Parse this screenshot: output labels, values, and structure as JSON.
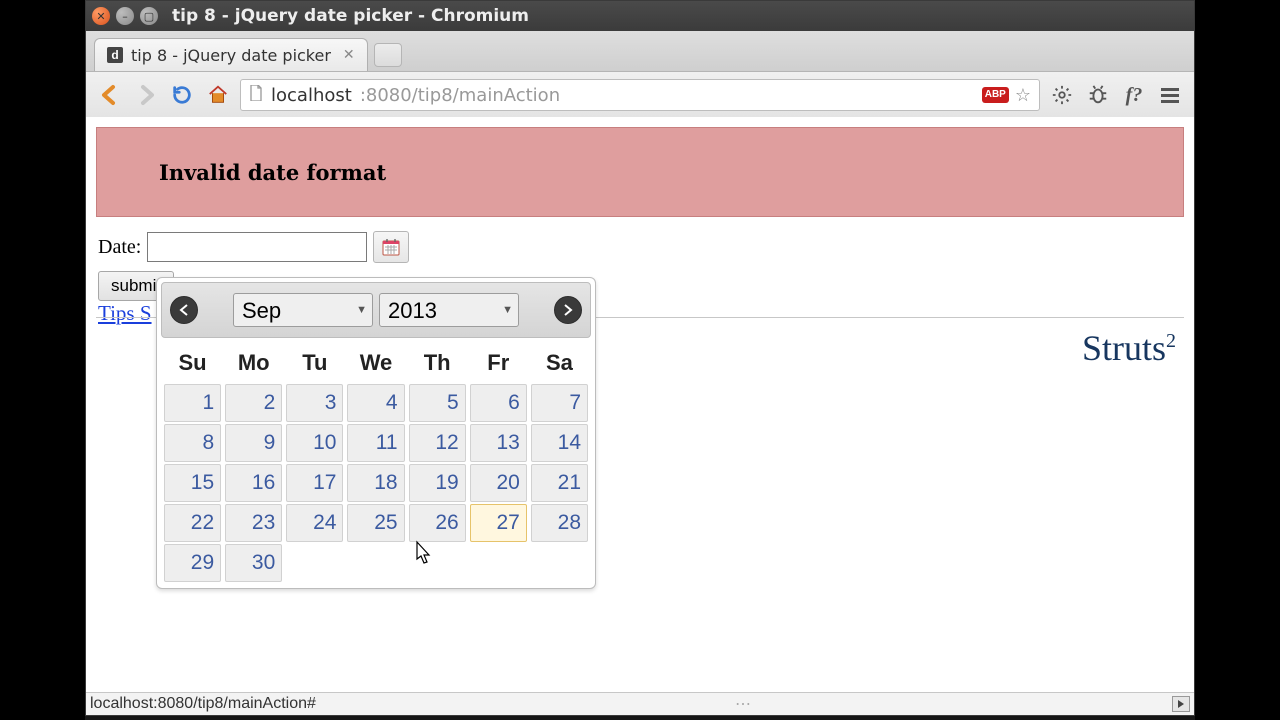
{
  "window": {
    "title": "tip 8 - jQuery date picker - Chromium"
  },
  "tab": {
    "title": "tip 8 - jQuery date picker",
    "favicon_letter": "d"
  },
  "addressbar": {
    "host": "localhost",
    "path": ":8080/tip8/mainAction",
    "abp_label": "ABP"
  },
  "page": {
    "error_message": "Invalid date format",
    "date_label": "Date:",
    "date_value": "",
    "submit_label": "submit",
    "tips_link": "Tips S",
    "struts_brand": "Struts",
    "struts_sup": "2"
  },
  "datepicker": {
    "month": "Sep",
    "year": "2013",
    "dow": [
      "Su",
      "Mo",
      "Tu",
      "We",
      "Th",
      "Fr",
      "Sa"
    ],
    "weeks": [
      [
        1,
        2,
        3,
        4,
        5,
        6,
        7
      ],
      [
        8,
        9,
        10,
        11,
        12,
        13,
        14
      ],
      [
        15,
        16,
        17,
        18,
        19,
        20,
        21
      ],
      [
        22,
        23,
        24,
        25,
        26,
        27,
        28
      ],
      [
        29,
        30,
        null,
        null,
        null,
        null,
        null
      ]
    ],
    "hover_day": 27
  },
  "statusbar": {
    "text": "localhost:8080/tip8/mainAction#"
  }
}
